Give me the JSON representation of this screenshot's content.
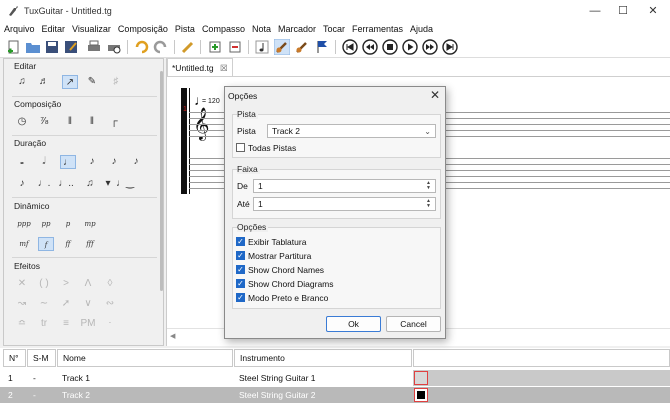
{
  "window": {
    "title": "TuxGuitar - Untitled.tg"
  },
  "menubar": {
    "items": [
      "Arquivo",
      "Editar",
      "Visualizar",
      "Composição",
      "Pista",
      "Compasso",
      "Nota",
      "Marcador",
      "Tocar",
      "Ferramentas",
      "Ajuda"
    ]
  },
  "sidepanel": {
    "groups": {
      "editar": "Editar",
      "composicao": "Composição",
      "duracao": "Duração",
      "dinamico": "Dinâmico",
      "efeitos": "Efeitos"
    },
    "dynamics": [
      "ppp",
      "pp",
      "p",
      "mp",
      "mf",
      "f",
      "ff",
      "fff"
    ]
  },
  "document": {
    "tab_label": "*Untitled.tg",
    "tab_close": "☒",
    "tempo": "= 120",
    "measure_number": "1"
  },
  "tracks_table": {
    "headers": {
      "num": "N°",
      "sm": "S-M",
      "name": "Nome",
      "instrument": "Instrumento"
    },
    "rows": [
      {
        "num": "1",
        "sm": "-",
        "name": "Track 1",
        "instrument": "Steel String Guitar 1"
      },
      {
        "num": "2",
        "sm": "-",
        "name": "Track 2",
        "instrument": "Steel String Guitar 2"
      }
    ]
  },
  "dialog": {
    "title": "Opções",
    "pista_group": "Pista",
    "pista_label": "Pista",
    "pista_value": "Track 2",
    "todas_pistas": "Todas Pistas",
    "faixa_group": "Faixa",
    "de_label": "De",
    "de_value": "1",
    "ate_label": "Até",
    "ate_value": "1",
    "opcoes_group": "Opções",
    "options": [
      {
        "label": "Exibir Tablatura",
        "checked": true
      },
      {
        "label": "Mostrar Partitura",
        "checked": true
      },
      {
        "label": "Show Chord Names",
        "checked": true
      },
      {
        "label": "Show Chord Diagrams",
        "checked": true
      },
      {
        "label": "Modo Preto e Branco",
        "checked": true
      }
    ],
    "ok": "Ok",
    "cancel": "Cancel"
  },
  "colors": {
    "accent": "#1f68c7",
    "selected_row": "#b9b9b9",
    "track_mark": "#e04040"
  }
}
